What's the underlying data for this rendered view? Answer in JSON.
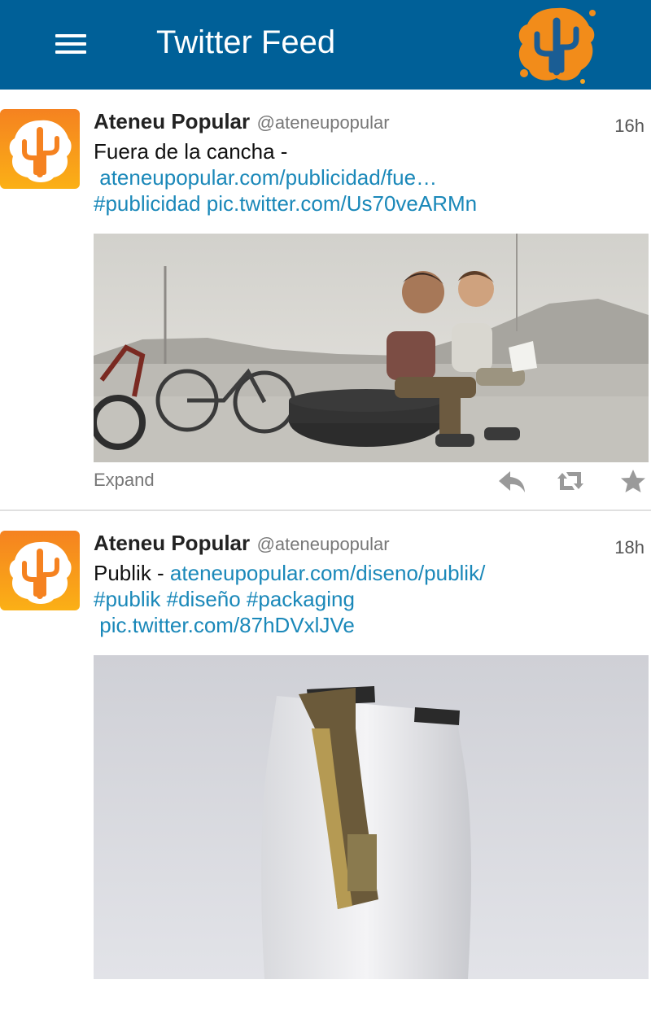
{
  "app_bar": {
    "title": "Twitter Feed",
    "background": "#006098",
    "menu_icon": "hamburger-menu-icon",
    "logo_icon": "cactus-logo-icon"
  },
  "colors": {
    "link": "#1a88b9",
    "brand_orange": "#f28c1a"
  },
  "tweets": [
    {
      "author_name": "Ateneu Popular",
      "author_handle": "@ateneupopular",
      "time": "16h",
      "text": "Fuera de la cancha -",
      "links": [
        "ateneupopular.com/publicidad/fue…",
        "#publicidad pic.twitter.com/Us70veARMn"
      ],
      "media_description_icon": "photo-kids-on-tire",
      "expand_label": "Expand",
      "action_icons": [
        "reply-icon",
        "retweet-icon",
        "favorite-star-icon"
      ]
    },
    {
      "author_name": "Ateneu Popular",
      "author_handle": "@ateneupopular",
      "time": "18h",
      "text": "Publik - ",
      "links": [
        "ateneupopular.com/diseno/publik/",
        "#publik #diseño #packaging",
        "pic.twitter.com/87hDVxlJVe"
      ],
      "media_description_icon": "photo-coffee-bag"
    }
  ]
}
